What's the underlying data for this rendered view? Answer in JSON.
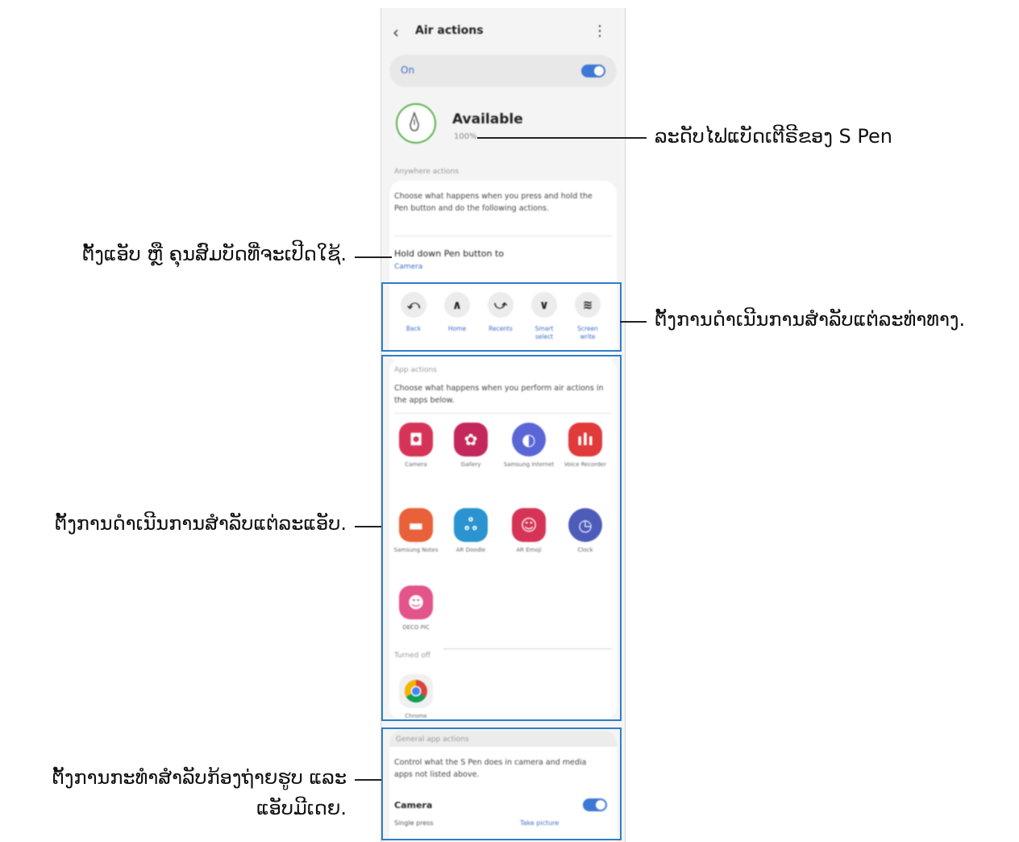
{
  "screen": {
    "title": "Air actions",
    "on_label": "On",
    "status": "Available",
    "battery": "100%",
    "anywhere_header": "Anywhere actions",
    "anywhere_desc": "Choose what happens when you press and hold the Pen button and do the following actions.",
    "hold_label": "Hold down Pen button to",
    "hold_value": "Camera",
    "gestures": [
      {
        "glyph": "⤺",
        "label": "Back"
      },
      {
        "glyph": "∧",
        "label": "Home"
      },
      {
        "glyph": "⤻",
        "label": "Recents"
      },
      {
        "glyph": "∨",
        "label": "Smart select"
      },
      {
        "glyph": "≋",
        "label": "Screen write"
      }
    ],
    "app_header": "App actions",
    "app_desc": "Choose what happens when you perform air actions in the apps below.",
    "apps": [
      {
        "name": "Camera",
        "icon": "camera-icon",
        "color": "#d63457"
      },
      {
        "name": "Gallery",
        "icon": "gallery-icon",
        "color": "#c4275a"
      },
      {
        "name": "Samsung Internet",
        "icon": "internet-icon",
        "color": "#5a66d6"
      },
      {
        "name": "Voice Recorder",
        "icon": "voice-recorder-icon",
        "color": "#e03a3a"
      },
      {
        "name": "Samsung Notes",
        "icon": "notes-icon",
        "color": "#e8613a"
      },
      {
        "name": "AR Doodle",
        "icon": "ar-doodle-icon",
        "color": "#2a93d0"
      },
      {
        "name": "AR Emoji",
        "icon": "ar-emoji-icon",
        "color": "#d63457"
      },
      {
        "name": "Clock",
        "icon": "clock-icon",
        "color": "#4d5cb8"
      },
      {
        "name": "DECO PIC",
        "icon": "deco-pic-icon",
        "color": "#e3548a"
      }
    ],
    "turned_off_label": "Turned off",
    "off_apps": [
      {
        "name": "Chrome",
        "icon": "chrome-icon"
      }
    ],
    "general_header": "General app actions",
    "general_desc": "Control what the S Pen does in camera and media apps not listed above.",
    "camera_label": "Camera",
    "single_press": "Single press",
    "take_picture": "Take picture"
  },
  "callouts": {
    "battery": "ລະດັບໄຟແບັດເຕີຣີຂອງ S Pen",
    "hold": "ຕັ້ງແອັບ ຫຼື ຄຸນສົມບັດທີ່ຈະເປີດໃຊ້.",
    "gestures": "ຕັ້ງການດຳເນີນການສຳລັບແຕ່ລະທ່າທາງ.",
    "apps": "ຕັ້ງການດຳເນີນການສຳລັບແຕ່ລະແອັບ.",
    "general_line1": "ຕັ້ງການກະທຳສຳລັບກ້ອງຖ່າຍຮູບ ແລະ",
    "general_line2": "ແອັບມີເດຍ."
  },
  "colors": {
    "accent": "#3e6cc7",
    "highlight": "#2f7ec7",
    "battery_ring": "#59b04a"
  }
}
